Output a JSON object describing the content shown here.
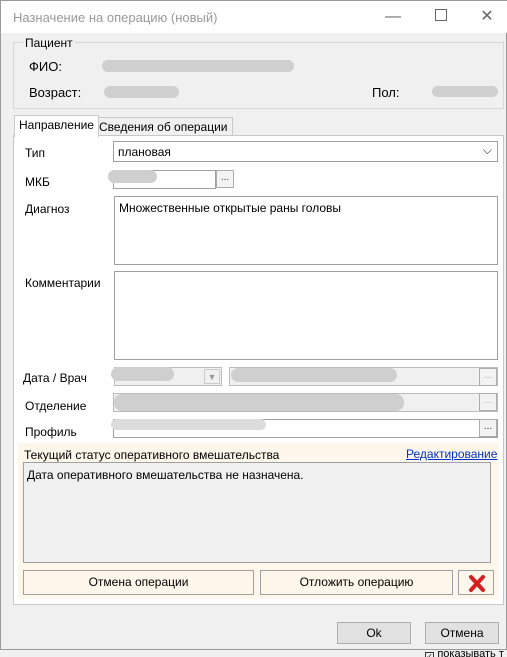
{
  "window": {
    "title": "Назначение на операцию (новый)"
  },
  "patient": {
    "group_label": "Пациент",
    "fio_label": "ФИО:",
    "age_label": "Возраст:",
    "sex_label": "Пол:"
  },
  "tabs": [
    {
      "label": "Направление",
      "active": true
    },
    {
      "label": "Сведения об операции",
      "active": false
    }
  ],
  "form": {
    "type_label": "Тип",
    "type_value": "плановая",
    "mkb_label": "МКБ",
    "diagnosis_label": "Диагноз",
    "diagnosis_value": "Множественные открытые раны головы",
    "comments_label": "Комментарии",
    "comments_value": "",
    "date_doctor_label": "Дата / Врач",
    "department_label": "Отделение",
    "profile_label": "Профиль",
    "dots": "..."
  },
  "status": {
    "title": "Текущий статус оперативного вмешательства",
    "edit_link": "Редактирование",
    "text": "Дата оперативного вмешательства не назначена."
  },
  "actions": {
    "cancel_operation": "Отмена операции",
    "postpone_operation": "Отложить операцию"
  },
  "dialog": {
    "ok": "Ok",
    "cancel": "Отмена"
  },
  "background": {
    "checkbox_label": "показывать т"
  },
  "colors": {
    "accent_link": "#0033cc",
    "status_bg": "#fdf6ea",
    "delete_red": "#d42020"
  }
}
